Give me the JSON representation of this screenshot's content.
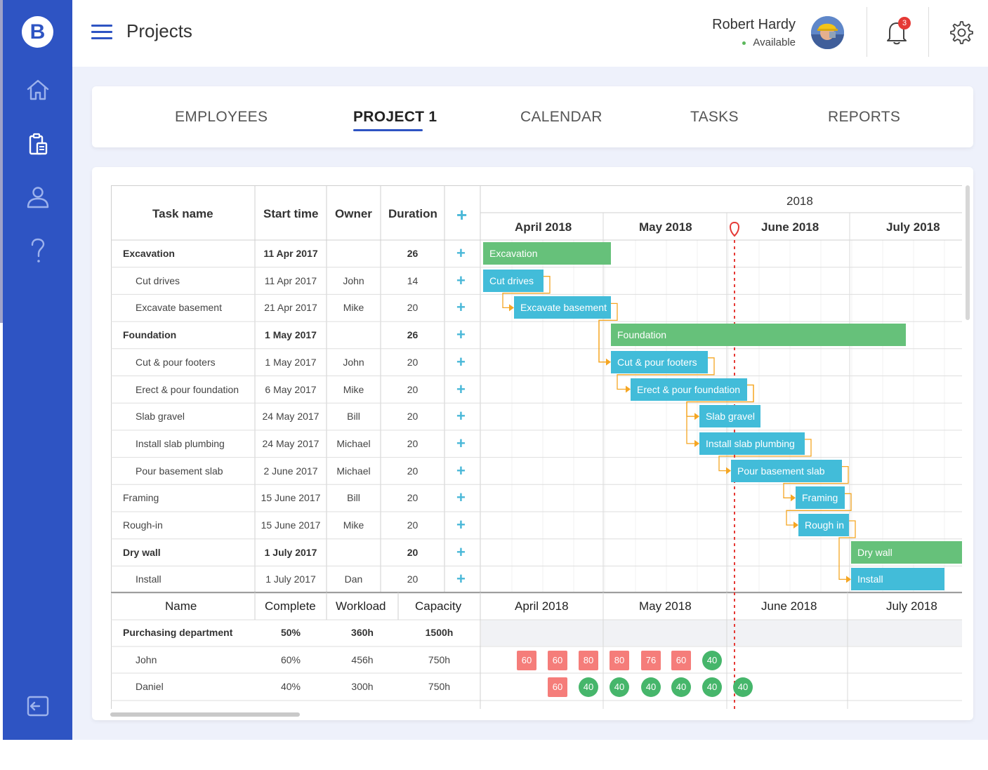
{
  "app": {
    "logo_letter": "B"
  },
  "header": {
    "title": "Projects",
    "user_name": "Robert Hardy",
    "user_status": "Available",
    "notification_count": "3"
  },
  "sidebar": {
    "items": [
      {
        "icon": "home-icon"
      },
      {
        "icon": "clipboard-icon",
        "active": true
      },
      {
        "icon": "user-icon"
      },
      {
        "icon": "help-icon"
      }
    ],
    "bottom_icon": "logout-icon"
  },
  "tabs": [
    {
      "label": "EMPLOYEES"
    },
    {
      "label": "PROJECT 1",
      "active": true
    },
    {
      "label": "CALENDAR"
    },
    {
      "label": "TASKS"
    },
    {
      "label": "REPORTS"
    }
  ],
  "task_table": {
    "headers": {
      "name": "Task name",
      "start": "Start time",
      "owner": "Owner",
      "duration": "Duration",
      "add": "+"
    },
    "rows": [
      {
        "name": "Excavation",
        "start": "11 Apr 2017",
        "owner": "",
        "duration": "26",
        "group": true
      },
      {
        "name": "Cut drives",
        "start": "11 Apr 2017",
        "owner": "John",
        "duration": "14",
        "group": false
      },
      {
        "name": "Excavate basement",
        "start": "21 Apr 2017",
        "owner": "Mike",
        "duration": "20",
        "group": false
      },
      {
        "name": "Foundation",
        "start": "1 May 2017",
        "owner": "",
        "duration": "26",
        "group": true
      },
      {
        "name": "Cut & pour footers",
        "start": "1 May 2017",
        "owner": "John",
        "duration": "20",
        "group": false
      },
      {
        "name": "Erect & pour foundation",
        "start": "6 May 2017",
        "owner": "Mike",
        "duration": "20",
        "group": false
      },
      {
        "name": "Slab gravel",
        "start": "24 May 2017",
        "owner": "Bill",
        "duration": "20",
        "group": false
      },
      {
        "name": "Install slab plumbing",
        "start": "24 May 2017",
        "owner": "Michael",
        "duration": "20",
        "group": false
      },
      {
        "name": "Pour basement slab",
        "start": "2 June 2017",
        "owner": "Michael",
        "duration": "20",
        "group": false
      },
      {
        "name": "Framing",
        "start": "15 June 2017",
        "owner": "Bill",
        "duration": "20",
        "group": false,
        "flat": true
      },
      {
        "name": "Rough-in",
        "start": "15 June 2017",
        "owner": "Mike",
        "duration": "20",
        "group": false,
        "flat": true
      },
      {
        "name": "Dry wall",
        "start": "1 July 2017",
        "owner": "",
        "duration": "20",
        "group": true
      },
      {
        "name": "Install",
        "start": "1 July 2017",
        "owner": "Dan",
        "duration": "20",
        "group": false
      }
    ]
  },
  "timeline": {
    "year": "2018",
    "months": [
      "April 2018",
      "May 2018",
      "June 2018",
      "July 2018"
    ],
    "bars": [
      {
        "label": "Excavation",
        "color": "green"
      },
      {
        "label": "Cut drives",
        "color": "blue"
      },
      {
        "label": "Excavate basement",
        "color": "blue"
      },
      {
        "label": "Foundation",
        "color": "green"
      },
      {
        "label": "Cut & pour footers",
        "color": "blue"
      },
      {
        "label": "Erect & pour foundation",
        "color": "blue"
      },
      {
        "label": "Slab gravel",
        "color": "blue"
      },
      {
        "label": "Install slab plumbing",
        "color": "blue"
      },
      {
        "label": "Pour basement slab",
        "color": "blue"
      },
      {
        "label": "Framing",
        "color": "blue"
      },
      {
        "label": "Rough in",
        "color": "blue"
      },
      {
        "label": "Dry wall",
        "color": "green"
      },
      {
        "label": "Install",
        "color": "blue"
      }
    ]
  },
  "resource_table": {
    "headers": {
      "name": "Name",
      "complete": "Complete",
      "workload": "Workload",
      "capacity": "Capacity"
    },
    "rows": [
      {
        "name": "Purchasing department",
        "complete": "50%",
        "workload": "360h",
        "capacity": "1500h",
        "group": true,
        "chips": []
      },
      {
        "name": "John",
        "complete": "60%",
        "workload": "456h",
        "capacity": "750h",
        "group": false,
        "chips": [
          {
            "v": "60",
            "c": "red"
          },
          {
            "v": "60",
            "c": "red"
          },
          {
            "v": "80",
            "c": "red"
          },
          {
            "v": "80",
            "c": "red"
          },
          {
            "v": "76",
            "c": "red"
          },
          {
            "v": "60",
            "c": "red"
          },
          {
            "v": "40",
            "c": "green"
          }
        ]
      },
      {
        "name": "Daniel",
        "complete": "40%",
        "workload": "300h",
        "capacity": "750h",
        "group": false,
        "chips": [
          {
            "v": "60",
            "c": "red"
          },
          {
            "v": "40",
            "c": "green"
          },
          {
            "v": "40",
            "c": "green"
          },
          {
            "v": "40",
            "c": "green"
          },
          {
            "v": "40",
            "c": "green"
          },
          {
            "v": "40",
            "c": "green"
          },
          {
            "v": "40",
            "c": "green"
          }
        ]
      }
    ]
  },
  "colors": {
    "brand": "#2e54c3",
    "bar_green": "#66c17a",
    "bar_blue": "#42bcd9",
    "link_orange": "#f5a623",
    "today_line": "#e53935"
  }
}
